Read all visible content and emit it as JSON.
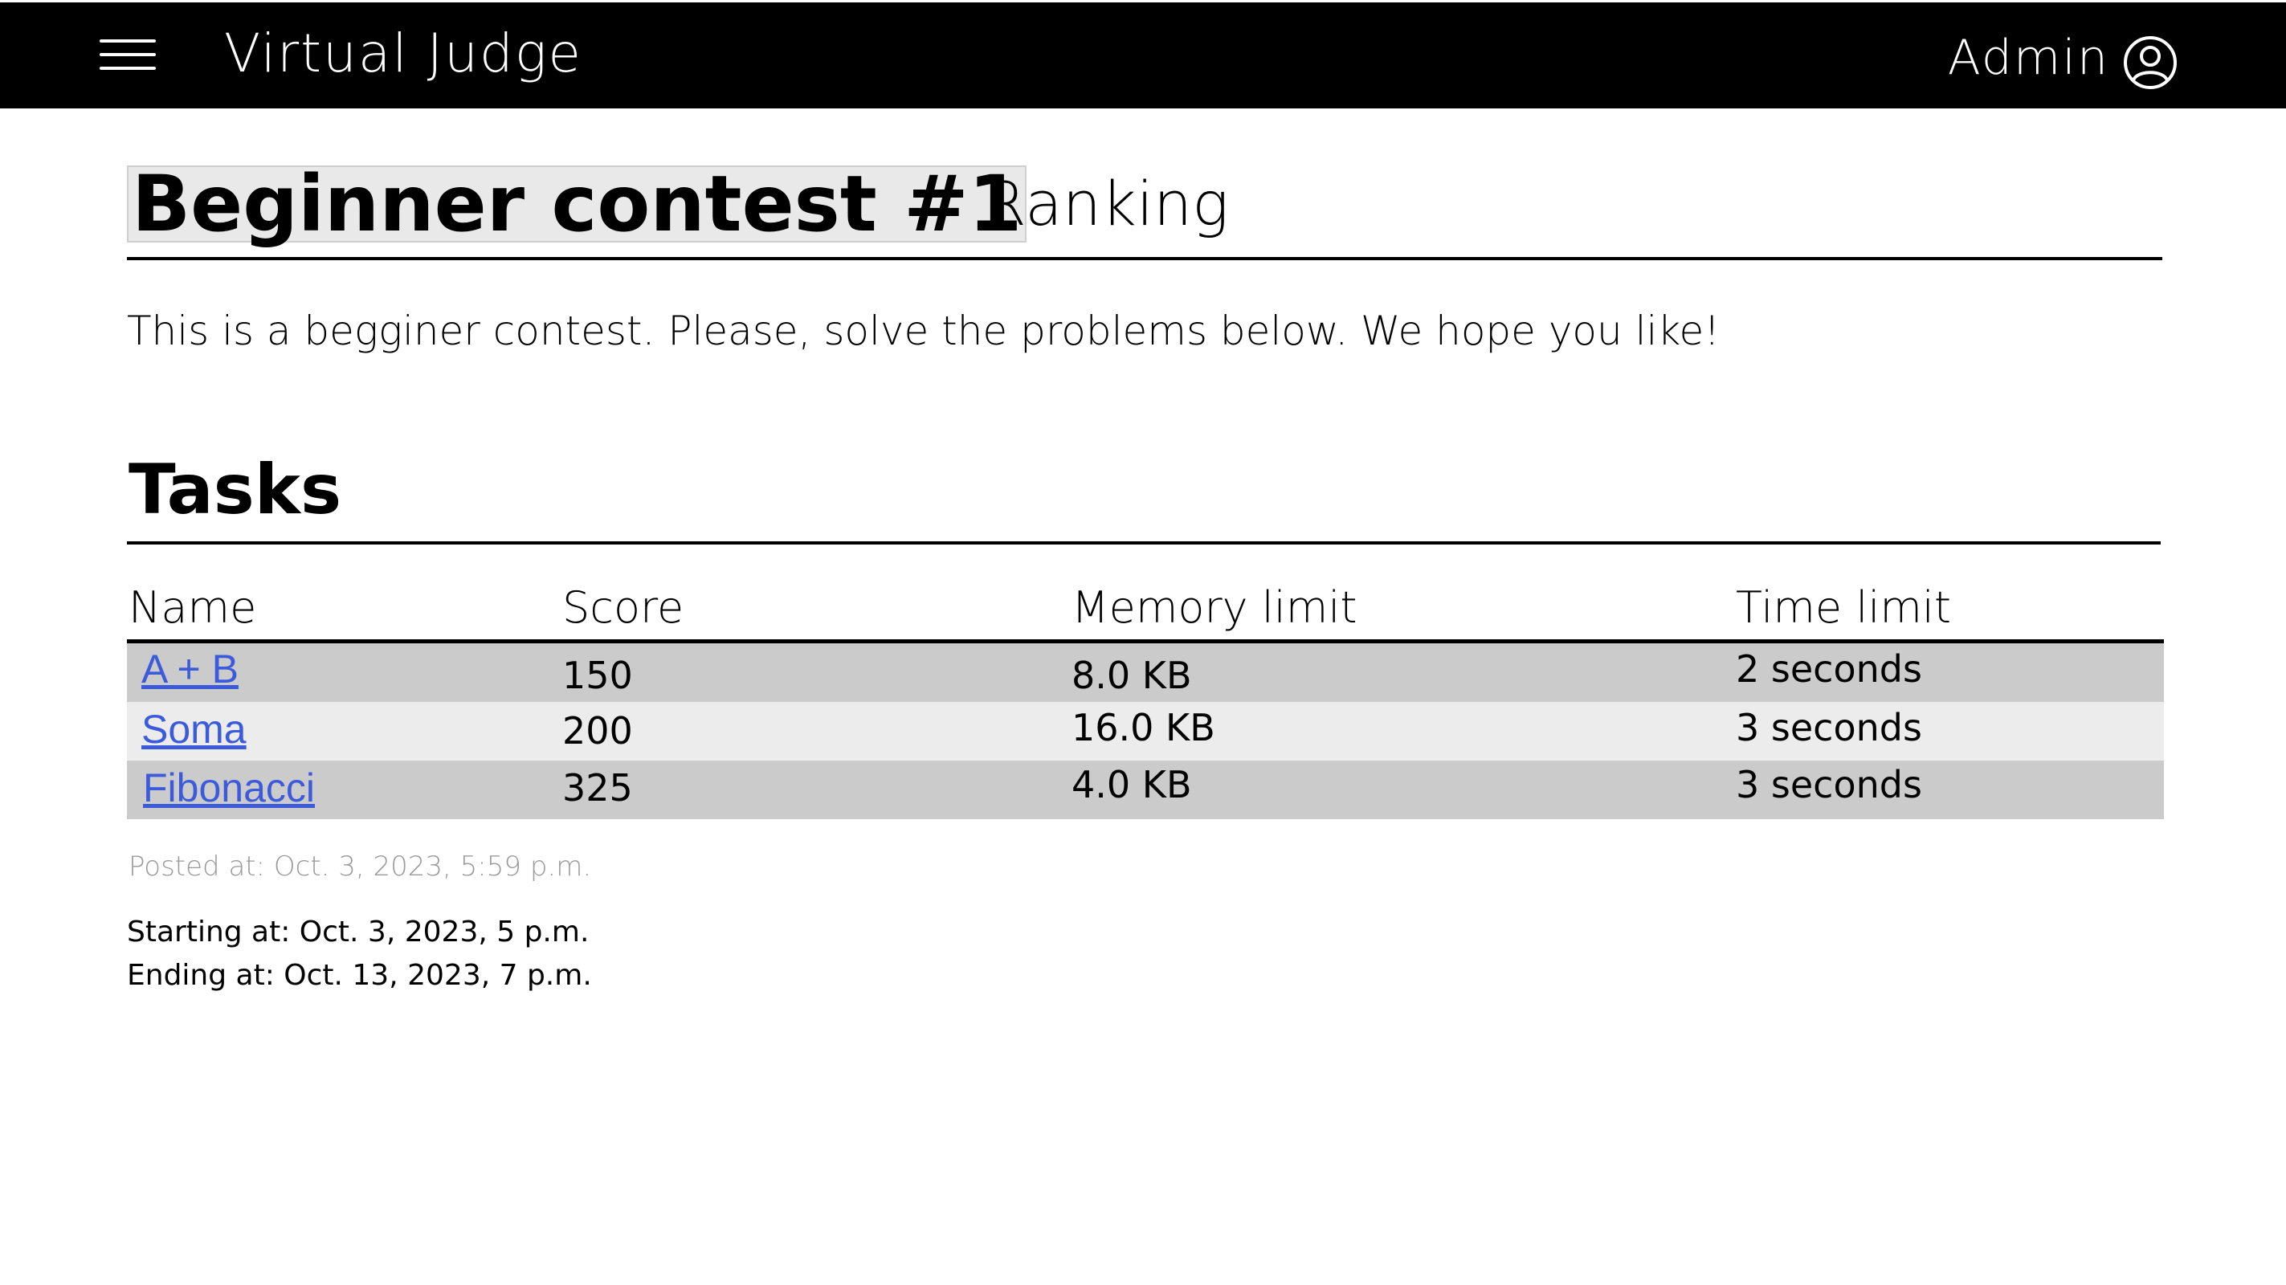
{
  "navbar": {
    "brand": "Virtual Judge",
    "user_name": "Admin",
    "menu_icon": "hamburger-menu-icon",
    "user_icon": "user-circle-icon",
    "background_color": "#000000",
    "text_color": "#ffffff"
  },
  "contest": {
    "title": "Beginner contest #1",
    "ranking_label": "Ranking",
    "description": "This is a begginer contest. Please, solve the problems below. We hope you like!"
  },
  "tasks": {
    "heading": "Tasks",
    "columns": [
      "Name",
      "Score",
      "Memory limit",
      "Time limit"
    ],
    "rows": [
      {
        "name": " A + B",
        "score": "150",
        "memory": "8.0 KB",
        "time": "2 seconds"
      },
      {
        "name": " Soma",
        "score": "200",
        "memory": "16.0 KB",
        "time": "3 seconds"
      },
      {
        "name": "Fibonacci",
        "score": "325",
        "memory": "4.0 KB",
        "time": "3 seconds"
      }
    ],
    "row_colors": [
      "#cbcbcb",
      "#ececec"
    ],
    "link_color": "#3b5bdb"
  },
  "meta": {
    "posted": "Posted at: Oct. 3, 2023, 5:59 p.m.",
    "starting": "Starting at: Oct. 3, 2023, 5 p.m.",
    "ending": "Ending at: Oct. 13, 2023, 7 p.m."
  }
}
